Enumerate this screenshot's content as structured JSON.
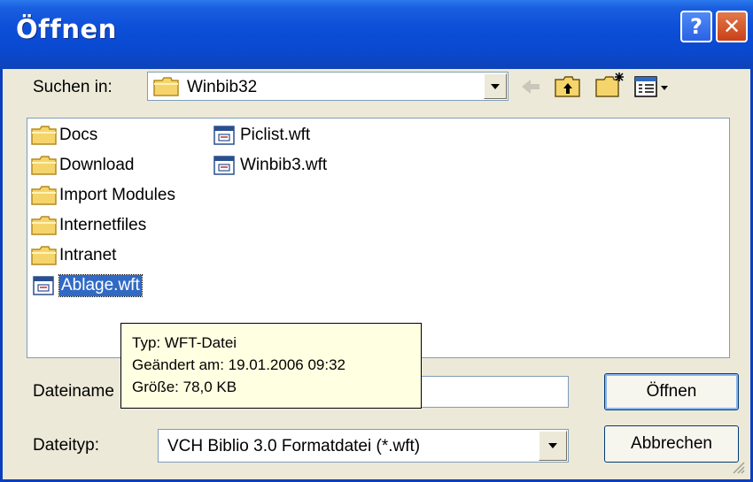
{
  "window": {
    "title": "Öffnen",
    "help_glyph": "?",
    "close_glyph": "✕"
  },
  "lookin": {
    "label": "Suchen in:",
    "value": "Winbib32"
  },
  "toolbar": {
    "back": "back-arrow-icon",
    "up": "up-folder-icon",
    "new_folder": "new-folder-icon",
    "view": "view-menu-icon"
  },
  "files": {
    "col1": [
      "Docs",
      "Download",
      "Import Modules",
      "Internetfiles",
      "Intranet"
    ],
    "selected": "Ablage.wft",
    "col2": [
      "Piclist.wft",
      "Winbib3.wft"
    ]
  },
  "tooltip": {
    "type": "Typ: WFT-Datei",
    "modified": "Geändert am: 19.01.2006 09:32",
    "size": "Größe: 78,0 KB"
  },
  "filename": {
    "label": "Dateiname",
    "value": ""
  },
  "filetype": {
    "label": "Dateityp:",
    "value": "VCH Biblio 3.0 Formatdatei (*.wft)"
  },
  "buttons": {
    "open": "Öffnen",
    "cancel": "Abbrechen"
  },
  "colors": {
    "title_blue": "#0a48cf",
    "selection": "#316ac5",
    "tooltip_bg": "#ffffe1",
    "dialog_bg": "#ece9d8"
  }
}
